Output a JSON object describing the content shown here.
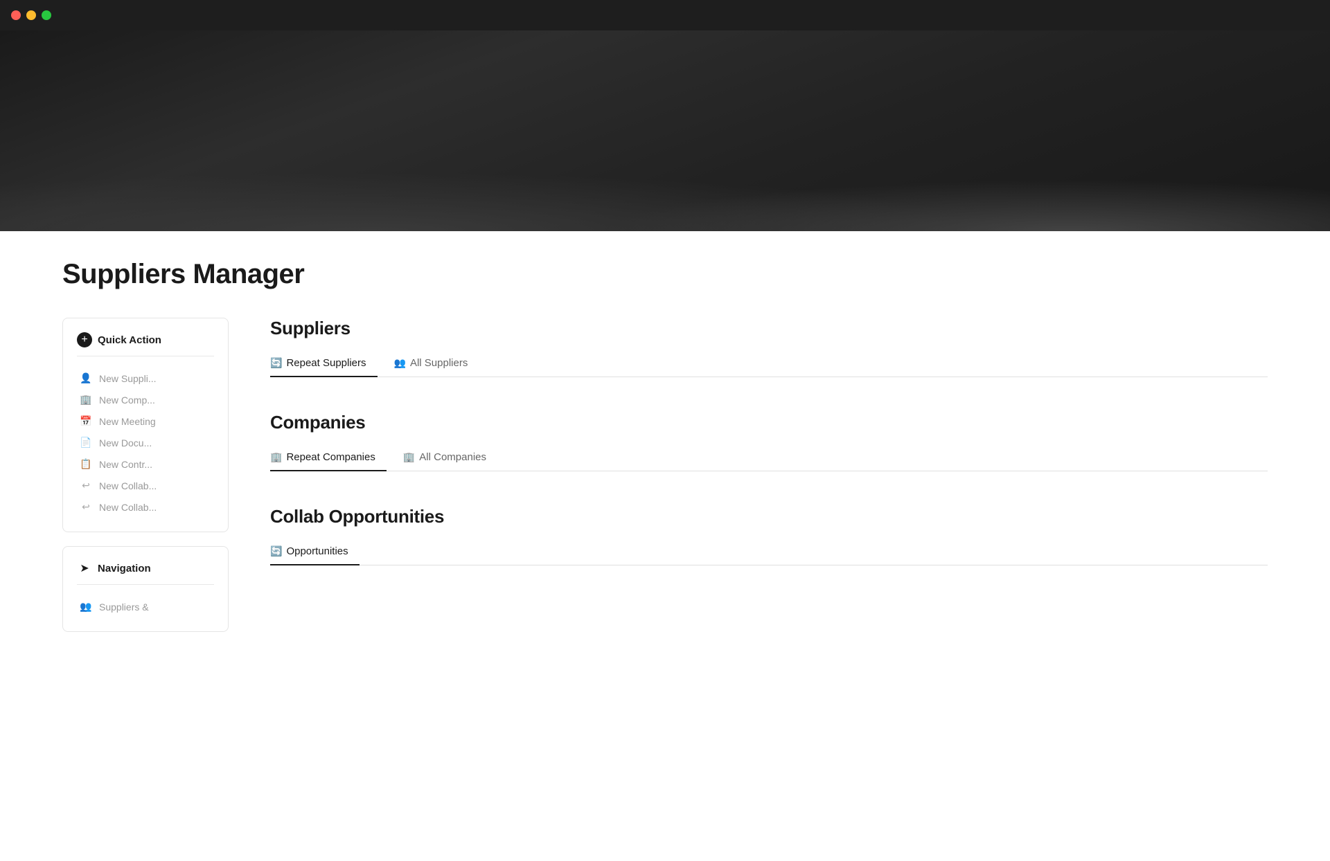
{
  "titlebar": {
    "lights": [
      "red",
      "yellow",
      "green"
    ]
  },
  "page": {
    "title": "Suppliers Manager"
  },
  "sidebar": {
    "quick_action_label": "Quick Action",
    "quick_action_icon": "+",
    "items": [
      {
        "id": "new-supplier",
        "label": "New Suppli...",
        "icon": "👤"
      },
      {
        "id": "new-company",
        "label": "New Comp...",
        "icon": "🏢"
      },
      {
        "id": "new-meeting",
        "label": "New Meeting",
        "icon": "📅"
      },
      {
        "id": "new-document",
        "label": "New Docu...",
        "icon": "📄"
      },
      {
        "id": "new-contract",
        "label": "New Contr...",
        "icon": "📋"
      },
      {
        "id": "new-collab1",
        "label": "New Collab...",
        "icon": "↩"
      },
      {
        "id": "new-collab2",
        "label": "New Collab...",
        "icon": "↩"
      }
    ],
    "navigation_label": "Navigation",
    "navigation_icon": "➤",
    "nav_items": [
      {
        "id": "suppliers-nav",
        "label": "Suppliers &",
        "icon": "👥"
      }
    ]
  },
  "sections": [
    {
      "id": "suppliers",
      "title": "Suppliers",
      "tabs": [
        {
          "id": "repeat-suppliers",
          "label": "Repeat Suppliers",
          "icon": "🔄",
          "active": true
        },
        {
          "id": "all-suppliers",
          "label": "All Suppliers",
          "icon": "👥",
          "active": false
        }
      ]
    },
    {
      "id": "companies",
      "title": "Companies",
      "tabs": [
        {
          "id": "repeat-companies",
          "label": "Repeat Companies",
          "icon": "🏢",
          "active": true
        },
        {
          "id": "all-companies",
          "label": "All Companies",
          "icon": "🏢",
          "active": false
        }
      ]
    },
    {
      "id": "collab",
      "title": "Collab Opportunities",
      "tabs": [
        {
          "id": "opportunities",
          "label": "Opportunities",
          "icon": "🔄",
          "active": true
        }
      ]
    }
  ]
}
